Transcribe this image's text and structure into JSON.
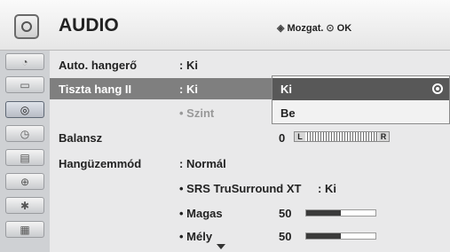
{
  "header": {
    "title": "AUDIO",
    "hint_move": "Mozgat.",
    "hint_ok": "OK"
  },
  "sidebar": {
    "items": [
      {
        "icon": "dish-icon"
      },
      {
        "icon": "screen-icon"
      },
      {
        "icon": "audio-icon",
        "active": true
      },
      {
        "icon": "clock-icon"
      },
      {
        "icon": "calendar-icon"
      },
      {
        "icon": "lock-icon"
      },
      {
        "icon": "bluetooth-icon"
      },
      {
        "icon": "clapper-icon"
      }
    ]
  },
  "rows": {
    "auto_volume": {
      "label": "Auto. hangerő",
      "value": ": Ki"
    },
    "clear_voice": {
      "label": "Tiszta hang II",
      "value": ": Ki"
    },
    "level": {
      "label": "• Szint"
    },
    "balance": {
      "label": "Balansz",
      "value": "0",
      "left": "L",
      "right": "R"
    },
    "sound_mode": {
      "label": "Hangüzemmód",
      "value": ": Normál"
    },
    "srs": {
      "label": "• SRS TruSurround XT",
      "value": ": Ki"
    },
    "treble": {
      "label": "• Magas",
      "value": "50",
      "level": 0.5
    },
    "bass": {
      "label": "• Mély",
      "value": "50",
      "level": 0.5
    }
  },
  "popup": {
    "options": [
      {
        "label": "Ki",
        "selected": true
      },
      {
        "label": "Be",
        "selected": false
      }
    ]
  }
}
